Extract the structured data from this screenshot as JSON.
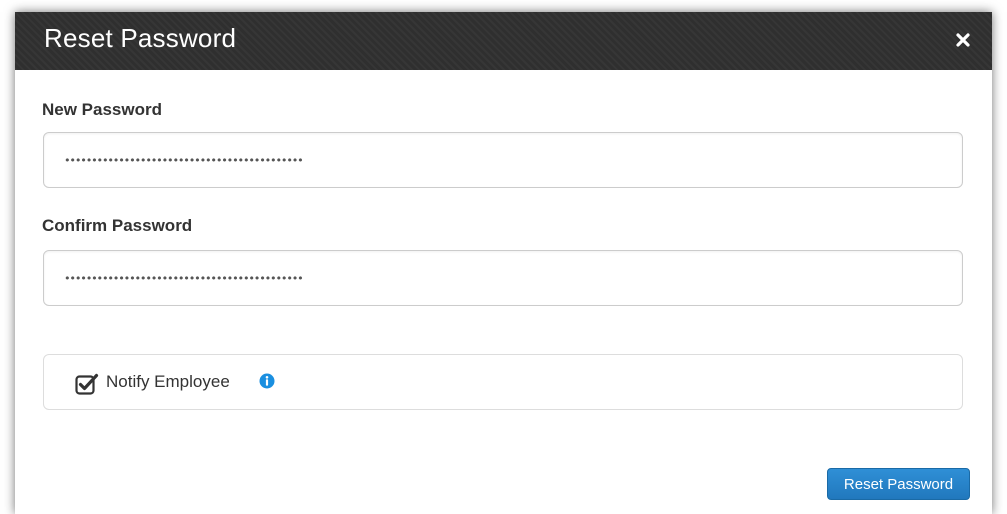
{
  "dialog": {
    "title": "Reset Password",
    "close_icon": "close-icon"
  },
  "new_password": {
    "label": "New Password",
    "value_masked": "••••••••••••••••••••••••••••••••••••••••••••"
  },
  "confirm_password": {
    "label": "Confirm Password",
    "value_masked": "••••••••••••••••••••••••••••••••••••••••••••"
  },
  "notify": {
    "label": "Notify Employee",
    "checked": true,
    "info_icon": "info-icon"
  },
  "actions": {
    "submit_label": "Reset Password"
  },
  "colors": {
    "header_bg": "#2f2f2f",
    "primary_button": "#2178bd",
    "info_icon": "#1a8fe0"
  }
}
